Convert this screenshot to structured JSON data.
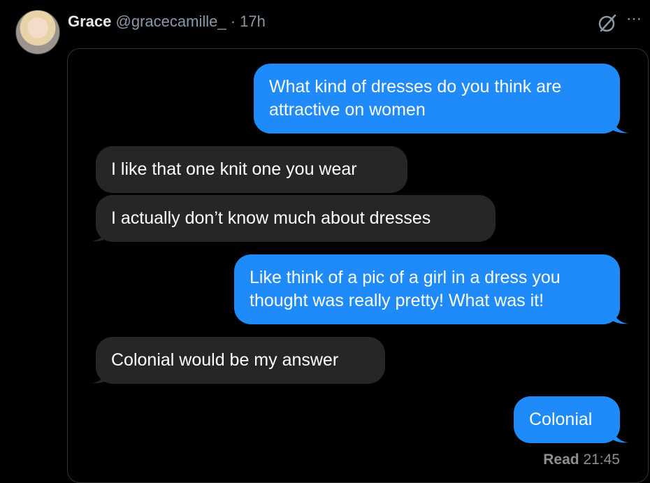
{
  "tweet": {
    "author_name": "Grace",
    "handle": "@gracecamille_",
    "time": "· 17h",
    "grok_icon": "grok-slash-circle-icon",
    "more_icon": "more-horizontal-icon"
  },
  "messages": [
    {
      "direction": "out",
      "lines": [
        "What kind of dresses do you think are",
        "attractive on women"
      ]
    },
    {
      "direction": "in",
      "lines": [
        "I like that one knit one you wear"
      ]
    },
    {
      "direction": "in",
      "lines": [
        "I actually don’t know much about dresses"
      ]
    },
    {
      "direction": "out",
      "lines": [
        "Like think of a pic of a girl in a dress you",
        "thought was really pretty! What was it!"
      ]
    },
    {
      "direction": "in",
      "lines": [
        "Colonial would be my answer"
      ]
    },
    {
      "direction": "out",
      "lines": [
        "Colonial"
      ]
    }
  ],
  "read_receipt": {
    "label": "Read",
    "time": "21:45"
  },
  "colors": {
    "outgoing": "#1f8bfa",
    "incoming": "#262628",
    "background": "#000000"
  }
}
